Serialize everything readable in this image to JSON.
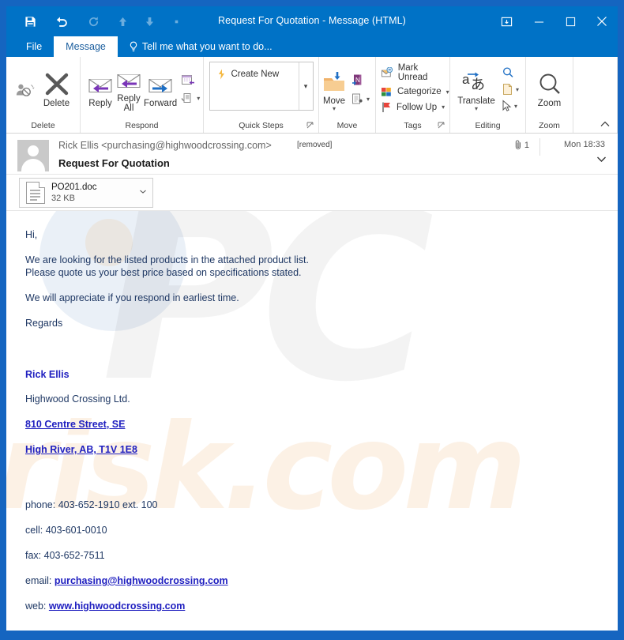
{
  "window": {
    "title": "Request For Quotation - Message (HTML)",
    "quick_access": [
      {
        "name": "save-icon",
        "label": "Save",
        "enabled": true
      },
      {
        "name": "undo-icon",
        "label": "Undo",
        "enabled": true
      },
      {
        "name": "redo-icon",
        "label": "Redo",
        "enabled": false
      },
      {
        "name": "previous-item-icon",
        "label": "Previous Item",
        "enabled": false
      },
      {
        "name": "next-item-icon",
        "label": "Next Item",
        "enabled": false
      },
      {
        "name": "customize-quick-access-toolbar-icon",
        "label": "Customize Quick Access Toolbar",
        "enabled": false
      }
    ],
    "controls": {
      "ribbon_display_options": "Ribbon Display Options",
      "minimize": "Minimize",
      "maximize": "Maximize",
      "close": "Close"
    }
  },
  "tabs": {
    "file": "File",
    "message": "Message",
    "tell_me": "Tell me what you want to do..."
  },
  "ribbon": {
    "groups": [
      {
        "label": "Delete",
        "buttons": [
          {
            "name": "junk-button",
            "label": ""
          },
          {
            "name": "delete-button",
            "label": "Delete"
          }
        ]
      },
      {
        "label": "Respond",
        "buttons": [
          {
            "name": "reply-button",
            "label": "Reply"
          },
          {
            "name": "reply-all-button",
            "label": "Reply All"
          },
          {
            "name": "forward-button",
            "label": "Forward"
          },
          {
            "name": "meeting-button",
            "label": ""
          },
          {
            "name": "more-respond-button",
            "label": ""
          }
        ]
      },
      {
        "label": "Quick Steps",
        "gallery_item": "Create New",
        "has_launcher": true
      },
      {
        "label": "Move",
        "buttons": [
          {
            "name": "move-button",
            "label": "Move"
          },
          {
            "name": "onenote-button",
            "label": ""
          },
          {
            "name": "rules-actions-button",
            "label": ""
          }
        ]
      },
      {
        "label": "Tags",
        "has_launcher": true,
        "items": [
          {
            "name": "mark-unread-button",
            "label": "Mark Unread"
          },
          {
            "name": "categorize-button",
            "label": "Categorize"
          },
          {
            "name": "follow-up-button",
            "label": "Follow Up"
          }
        ]
      },
      {
        "label": "Editing",
        "buttons": [
          {
            "name": "translate-button",
            "label": "Translate"
          },
          {
            "name": "find-button",
            "label": ""
          },
          {
            "name": "related-button",
            "label": ""
          },
          {
            "name": "select-button",
            "label": ""
          }
        ]
      },
      {
        "label": "Zoom",
        "buttons": [
          {
            "name": "zoom-button",
            "label": "Zoom"
          }
        ]
      }
    ],
    "collapse_label": "Collapse the Ribbon"
  },
  "message": {
    "sender": "Rick Ellis <purchasing@highwoodcrossing.com>",
    "recipient_tag": "[removed]",
    "subject": "Request For Quotation",
    "attachment_count": "1",
    "date": "Mon 18:33",
    "attachment": {
      "file_name": "PO201.doc",
      "file_size": "32 KB"
    }
  },
  "body": {
    "greeting": "Hi,",
    "para1_line1": "We are looking for the listed products in the attached product list.",
    "para1_line2": "Please quote us your best price based on specifications stated.",
    "para2": "We will appreciate if you respond in earliest time.",
    "closing": "Regards",
    "signature": {
      "name": "Rick Ellis",
      "company": "Highwood Crossing Ltd.",
      "address_line1": "810 Centre Street, SE",
      "address_line2": "High River, AB, T1V 1E8",
      "phone_label": "phone: ",
      "phone": "403-652-1910 ext. 100",
      "cell_label": "cell: ",
      "cell": "403-601-0010",
      "fax_label": "fax: ",
      "fax": "403-652-7511",
      "email_label": "email: ",
      "email": "purchasing@highwoodcrossing.com",
      "web_label": "web: ",
      "web": "www.highwoodcrossing.com"
    }
  },
  "watermark": {
    "primary": "PC",
    "secondary": "risk.com"
  },
  "colors": {
    "title_bar": "#0072c6",
    "window_border": "#1565c0",
    "body_text": "#1f3864",
    "link": "#2020c0",
    "accent_orange": "#f0a050"
  }
}
